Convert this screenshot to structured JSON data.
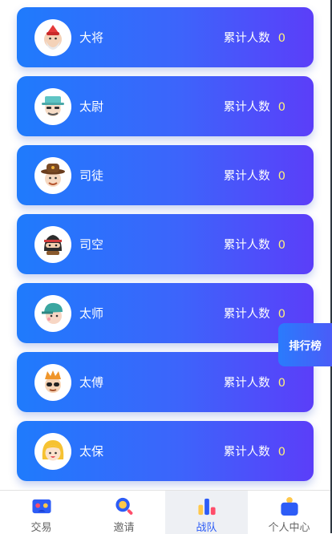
{
  "ranks": [
    {
      "name": "大将",
      "count_label": "累计人数",
      "count": "0",
      "icon": "general-avatar-icon"
    },
    {
      "name": "太尉",
      "count_label": "累计人数",
      "count": "0",
      "icon": "hat-avatar-icon"
    },
    {
      "name": "司徒",
      "count_label": "累计人数",
      "count": "0",
      "icon": "cowboy-avatar-icon"
    },
    {
      "name": "司空",
      "count_label": "累计人数",
      "count": "0",
      "icon": "ninja-avatar-icon"
    },
    {
      "name": "太师",
      "count_label": "累计人数",
      "count": "0",
      "icon": "cap-avatar-icon"
    },
    {
      "name": "太傅",
      "count_label": "累计人数",
      "count": "0",
      "icon": "crown-avatar-icon"
    },
    {
      "name": "太保",
      "count_label": "累计人数",
      "count": "0",
      "icon": "girl-avatar-icon"
    }
  ],
  "float_button": "排行榜",
  "tabs": [
    {
      "label": "交易",
      "icon": "trade-icon"
    },
    {
      "label": "邀请",
      "icon": "invite-search-icon"
    },
    {
      "label": "战队",
      "icon": "team-chart-icon",
      "active": true
    },
    {
      "label": "个人中心",
      "icon": "profile-bag-icon"
    }
  ],
  "colors": {
    "card_start": "#1f7bfc",
    "card_end": "#5b3ef9",
    "active_tab": "#2d5cf6",
    "count_value": "#fff27a"
  }
}
